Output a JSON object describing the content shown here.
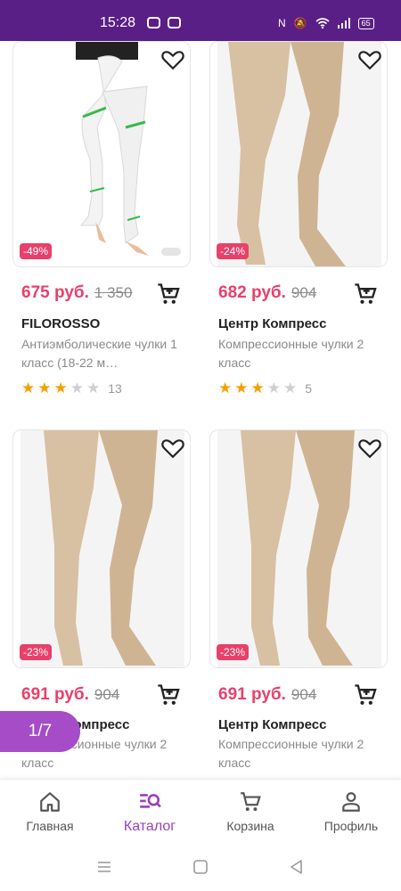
{
  "status_bar": {
    "time": "15:28",
    "battery": "65"
  },
  "products": [
    {
      "price": "675 руб.",
      "old_price": "1 350",
      "discount": "-49%",
      "brand": "FILOROSSO",
      "description": "Антиэмболические чулки 1 класс (18-22 м…",
      "rating": 3,
      "reviews": "13"
    },
    {
      "price": "682 руб.",
      "old_price": "904",
      "discount": "-24%",
      "brand": "Центр Компресс",
      "description": "Компрессионные чулки 2 класс",
      "rating": 3,
      "reviews": "5"
    },
    {
      "price": "691 руб.",
      "old_price": "904",
      "discount": "-23%",
      "brand": "Центр Компресс",
      "description": "Компрессионные чулки 2 класс"
    },
    {
      "price": "691 руб.",
      "old_price": "904",
      "discount": "-23%",
      "brand": "Центр Компресс",
      "description": "Компрессионные чулки 2 класс"
    }
  ],
  "page_indicator": "1/7",
  "nav": {
    "items": [
      {
        "label": "Главная",
        "icon": "home-icon"
      },
      {
        "label": "Каталог",
        "icon": "catalog-icon"
      },
      {
        "label": "Корзина",
        "icon": "cart-icon"
      },
      {
        "label": "Профиль",
        "icon": "profile-icon"
      }
    ],
    "active": "Каталог"
  },
  "colors": {
    "accent": "#9b3fbd",
    "price": "#e8406a",
    "status_bar": "#5a1f86",
    "star": "#f5a000"
  }
}
